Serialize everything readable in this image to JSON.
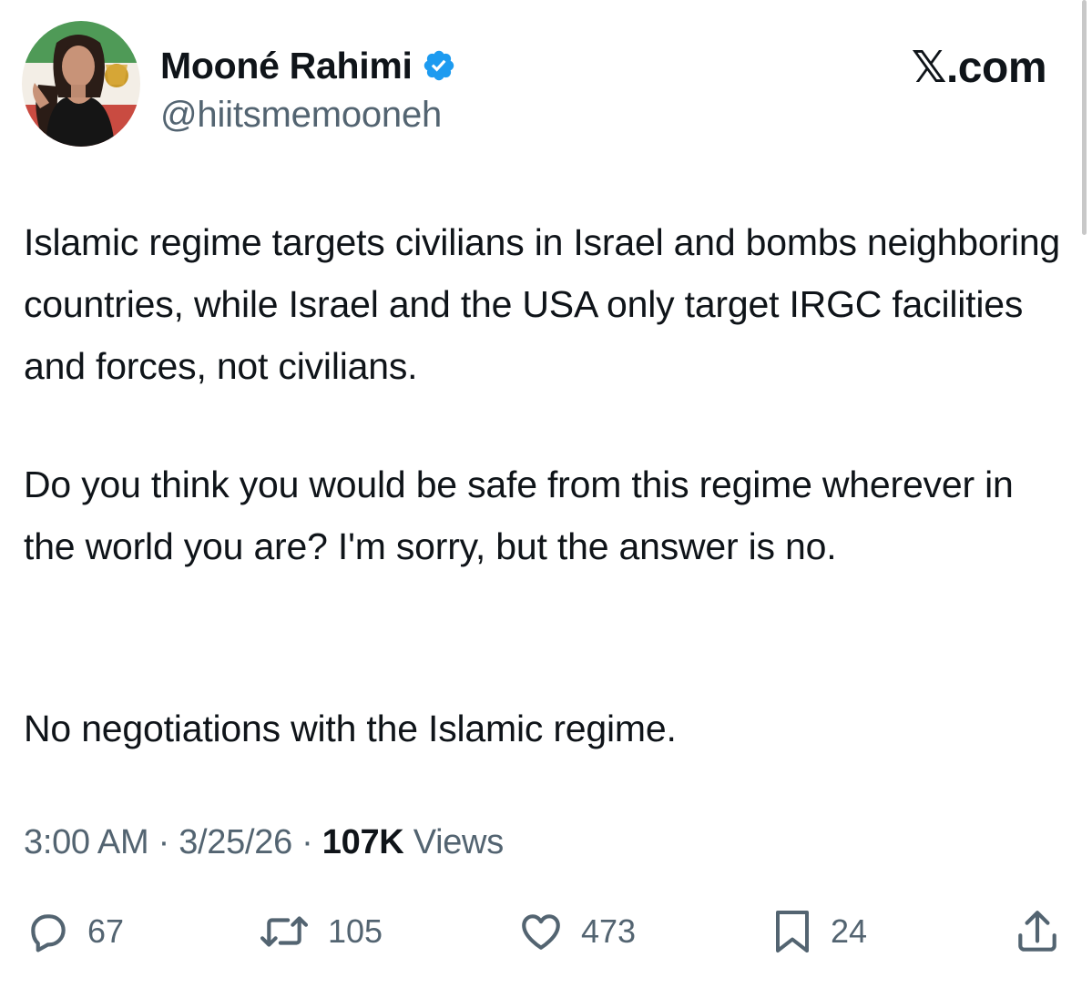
{
  "author": {
    "display_name": "Mooné Rahimi",
    "handle": "@hiitsmemooneh",
    "verified_icon": "verified-badge-icon",
    "avatar_icon": "avatar"
  },
  "brand": "𝕏.com",
  "tweet": {
    "paragraphs": [
      "Islamic regime targets civilians in Israel and bombs neighboring countries, while Israel and the USA only target IRGC facilities and forces, not civilians.",
      "Do you think you would be safe from this regime wherever in the world you are? I'm sorry, but the answer is no.",
      "No negotiations with the Islamic regime."
    ],
    "time": "3:00 AM",
    "date": "3/25/26",
    "separator": "·",
    "views_count": "107K",
    "views_label": "Views"
  },
  "actions": {
    "replies": "67",
    "reposts": "105",
    "likes": "473",
    "bookmarks": "24"
  },
  "colors": {
    "text": "#0f1419",
    "secondary": "#536471",
    "verified": "#1d9bf0",
    "background": "#ffffff"
  }
}
